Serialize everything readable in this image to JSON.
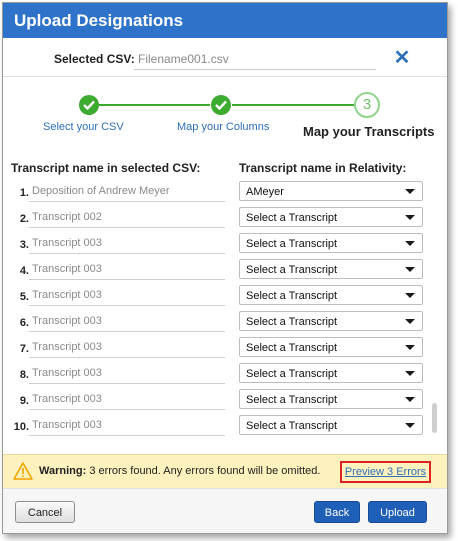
{
  "dialog": {
    "title": "Upload Designations"
  },
  "csv": {
    "label": "Selected CSV:",
    "filename": "Filename001.csv",
    "clear_icon": "close-icon"
  },
  "steps": [
    {
      "label": "Select your CSV",
      "state": "done"
    },
    {
      "label": "Map your Columns",
      "state": "done"
    },
    {
      "label": "Map your Transcripts",
      "number": "3",
      "state": "active"
    }
  ],
  "columns": {
    "left": "Transcript name in selected CSV:",
    "right": "Transcript name in Relativity:"
  },
  "rows": [
    {
      "num": "1.",
      "csv_name": "Deposition of Andrew Meyer",
      "selection": "AMeyer"
    },
    {
      "num": "2.",
      "csv_name": "Transcript 002",
      "selection": "Select a Transcript"
    },
    {
      "num": "3.",
      "csv_name": "Transcript 003",
      "selection": "Select a Transcript"
    },
    {
      "num": "4.",
      "csv_name": "Transcript 003",
      "selection": "Select a Transcript"
    },
    {
      "num": "5.",
      "csv_name": "Transcript 003",
      "selection": "Select a Transcript"
    },
    {
      "num": "6.",
      "csv_name": "Transcript 003",
      "selection": "Select a Transcript"
    },
    {
      "num": "7.",
      "csv_name": "Transcript 003",
      "selection": "Select a Transcript"
    },
    {
      "num": "8.",
      "csv_name": "Transcript 003",
      "selection": "Select a Transcript"
    },
    {
      "num": "9.",
      "csv_name": "Transcript 003",
      "selection": "Select a Transcript"
    },
    {
      "num": "10.",
      "csv_name": "Transcript 003",
      "selection": "Select a Transcript"
    }
  ],
  "warning": {
    "label": "Warning:",
    "message": "3 errors found. Any errors found will be omitted.",
    "link": "Preview 3 Errors",
    "icon": "warning-triangle-icon"
  },
  "footer": {
    "cancel": "Cancel",
    "back": "Back",
    "upload": "Upload"
  },
  "colors": {
    "titlebar": "#2e73c9",
    "step_done": "#3cab2f",
    "primary_button": "#1f5fb7",
    "warning_bg": "#fdf1be",
    "error_outline": "#dd2222"
  }
}
